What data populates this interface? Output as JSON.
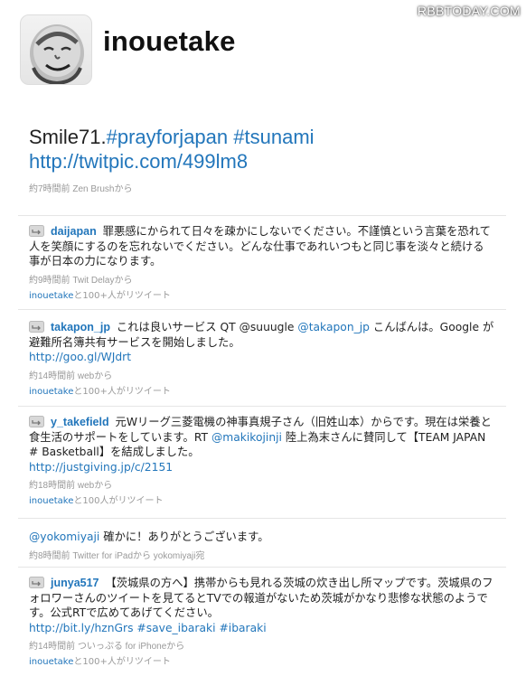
{
  "watermark": "RBBTODAY.COM",
  "profile": {
    "username": "inouetake"
  },
  "main_tweet": {
    "text_plain": "Smile71.",
    "hashtag1": "#prayforjapan",
    "hashtag2": "#tsunami",
    "link": "http://twitpic.com/499lm8",
    "meta": "約7時間前 Zen Brushから"
  },
  "tweets": [
    {
      "screen_name": "daijapan",
      "text": "罪悪感にかられて日々を疎かにしないでください。不謹慎という言葉を恐れて人を笑顔にするのを忘れないでください。どんな仕事であれいつもと同じ事を淡々と続ける事が日本の力になります。",
      "meta": "約9時間前 Twit Delayから",
      "rt_user": "inouetake",
      "rt_suffix": "と100+人がリツイート"
    },
    {
      "screen_name": "takapon_jp",
      "text_before": "これは良いサービス QT @suuugle ",
      "mention": "@takapon_jp",
      "text_after": " こんばんは。Google が避難所名簿共有サービスを開始しました。",
      "link": "http://goo.gl/WJdrt",
      "meta": "約14時間前 webから",
      "rt_user": "inouetake",
      "rt_suffix": "と100+人がリツイート"
    },
    {
      "screen_name": "y_takefield",
      "text_before": "元Wリーグ三菱電機の神事真規子さん（旧姓山本）からです。現在は栄養と食生活のサポートをしています。RT ",
      "mention": "@makikojinji",
      "text_after": " 陸上為末さんに賛同して【TEAM JAPAN # Basketball】を結成しました。",
      "link": "http://justgiving.jp/c/2151",
      "meta": "約18時間前 webから",
      "rt_user": "inouetake",
      "rt_suffix": "と100人がリツイート"
    },
    {
      "mention": "@yokomiyaji",
      "text": " 確かに！ありがとうございます。",
      "meta": "約8時間前 Twitter for iPadから yokomiyaji宛"
    },
    {
      "screen_name": "junya517",
      "text": "【茨城県の方へ】携帯からも見れる茨城の炊き出し所マップです。茨城県のフォロワーさんのツイートを見てるとTVでの報道がないため茨城がかなり悲惨な状態のようです。公式RTで広めてあげてください。",
      "link": "http://bit.ly/hznGrs",
      "hashtag1": "#save_ibaraki",
      "hashtag2": "#ibaraki",
      "meta": "約14時間前 ついっぷる for iPhoneから",
      "rt_user": "inouetake",
      "rt_suffix": "と100+人がリツイート"
    }
  ]
}
